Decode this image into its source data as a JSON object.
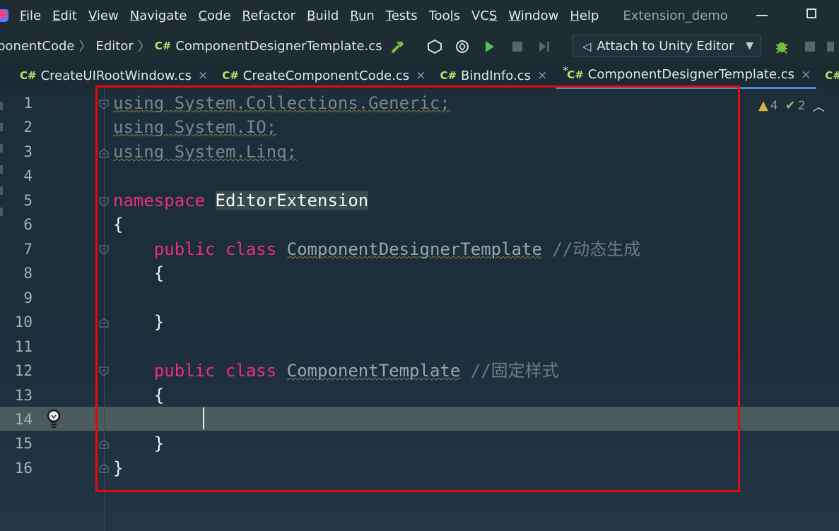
{
  "menubar": {
    "items": [
      {
        "mn": "F",
        "rest": "ile"
      },
      {
        "mn": "E",
        "rest": "dit"
      },
      {
        "mn": "V",
        "rest": "iew"
      },
      {
        "mn": "N",
        "rest": "avigate"
      },
      {
        "mn": "C",
        "rest": "ode"
      },
      {
        "mn": "R",
        "rest": "efactor"
      },
      {
        "mn": "B",
        "rest": "uild"
      },
      {
        "mn": "R",
        "rest": "un"
      },
      {
        "mn": "T",
        "rest": "ests"
      },
      {
        "pre": "Too",
        "mn": "l",
        "rest": "s"
      },
      {
        "pre": "VC",
        "mn": "S",
        "rest": ""
      },
      {
        "mn": "W",
        "rest": "indow"
      },
      {
        "mn": "H",
        "rest": "elp"
      }
    ],
    "project_name": "Extension_demo"
  },
  "navbar": {
    "crumb1": "ponentCode",
    "crumb2": "Editor",
    "crumb3_badge": "C#",
    "crumb3": "ComponentDesignerTemplate.cs",
    "attach_label": "Attach to Unity Editor"
  },
  "tabs": [
    {
      "badge": "C#",
      "label": "CreateUIRootWindow.cs",
      "close": "×"
    },
    {
      "badge": "C#",
      "label": "CreateComponentCode.cs",
      "close": "×"
    },
    {
      "badge": "C#",
      "label": "BindInfo.cs",
      "close": "×"
    },
    {
      "badge": "C#",
      "label": "ComponentDesignerTemplate.cs",
      "close": "×",
      "modified": "*"
    },
    {
      "badge": "C#",
      "label": "",
      "close": ""
    }
  ],
  "editor": {
    "line_numbers": [
      "1",
      "2",
      "3",
      "4",
      "5",
      "6",
      "7",
      "8",
      "9",
      "10",
      "11",
      "12",
      "13",
      "14",
      "15",
      "16"
    ],
    "current_line": 14,
    "code": {
      "l1": "using System.Collections.Generic;",
      "l2": "using System.IO;",
      "l3": "using System.Linq;",
      "l5_kw": "namespace",
      "l5_name": "EditorExtension",
      "l6": "{",
      "l7_kw1": "public",
      "l7_kw2": "class",
      "l7_name": "ComponentDesignerTemplate",
      "l7_comment": "//动态生成",
      "l8": "{",
      "l10": "}",
      "l12_kw1": "public",
      "l12_kw2": "class",
      "l12_name": "ComponentTemplate",
      "l12_comment": "//固定样式",
      "l13": "{",
      "l15": "}",
      "l16": "}"
    },
    "inspections": {
      "warnings": "4",
      "ok": "2"
    }
  },
  "colors": {
    "keyword": "#ec2f7d",
    "highlight_box": "#e30b0b",
    "active_tab_underline": "#4a8ad1"
  }
}
